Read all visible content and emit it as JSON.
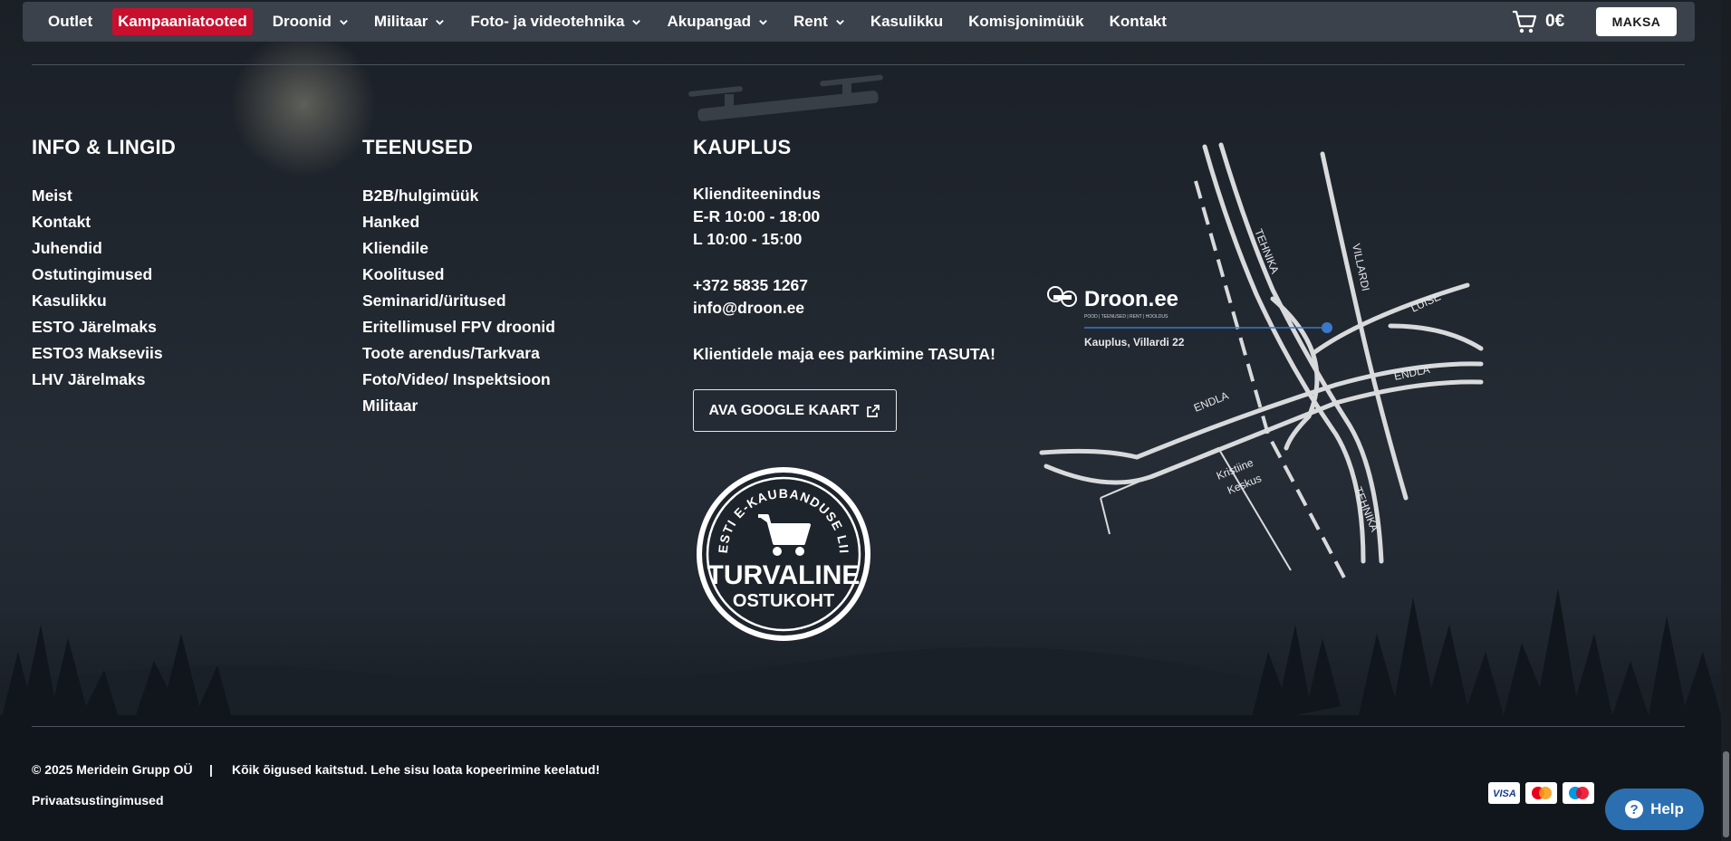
{
  "nav": {
    "items": [
      {
        "label": "Outlet",
        "dropdown": false
      },
      {
        "label": "Kampaaniatooted",
        "dropdown": false
      },
      {
        "label": "Droonid",
        "dropdown": true
      },
      {
        "label": "Militaar",
        "dropdown": true
      },
      {
        "label": "Foto- ja videotehnika",
        "dropdown": true
      },
      {
        "label": "Akupangad",
        "dropdown": true
      },
      {
        "label": "Rent",
        "dropdown": true
      },
      {
        "label": "Kasulikku",
        "dropdown": false
      },
      {
        "label": "Komisjonimüük",
        "dropdown": false
      },
      {
        "label": "Kontakt",
        "dropdown": false
      }
    ],
    "cart_total": "0€",
    "checkout_label": "MAKSA"
  },
  "footer": {
    "info": {
      "title": "INFO & LINGID",
      "links": [
        "Meist",
        "Kontakt",
        "Juhendid",
        "Ostutingimused",
        "Kasulikku",
        "ESTO Järelmaks",
        "ESTO3 Makseviis",
        "LHV Järelmaks"
      ]
    },
    "services": {
      "title": "TEENUSED",
      "links": [
        "B2B/hulgimüük",
        "Hanked",
        "Kliendile",
        "Koolitused",
        "Seminarid/üritused",
        "Eritellimusel FPV droonid",
        "Toote arendus/Tarkvara",
        "Foto/Video/ Inspektsioon",
        "Militaar"
      ]
    },
    "store": {
      "title": "KAUPLUS",
      "hours_title": "Klienditeenindus",
      "hours_weekdays": "E-R 10:00 - 18:00",
      "hours_saturday": "L 10:00 - 15:00",
      "phone": "+372 5835 1267",
      "email": "info@droon.ee",
      "parking": "Klientidele maja ees parkimine TASUTA!",
      "maps_button": "AVA GOOGLE KAART"
    },
    "badge": {
      "arc_text": "EESTI E-KAUBANDUSE LIIT",
      "line1": "TURVALINE",
      "line2": "OSTUKOHT"
    },
    "map": {
      "brand": "Droon.ee",
      "brand_sub": "POOD | TEENUSED | RENT | HOOLDUS",
      "address": "Kauplus, Villardi 22",
      "streets": [
        "TEHNIKA",
        "VILLARDI",
        "LUISE",
        "ENDLA",
        "ENDLA",
        "TEHNIKA"
      ],
      "mall_line1": "Kristiine",
      "mall_line2": "Keskus"
    },
    "copyright": "© 2025 Meridein Grupp OÜ",
    "separator": "|",
    "rights": "Kõik õigused kaitstud. Lehe sisu loata kopeerimine keelatud!",
    "privacy": "Privaatsustingimused",
    "payments": [
      "VISA",
      "Mastercard",
      "Maestro"
    ],
    "help_label": "Help"
  },
  "colors": {
    "campaign_red": "#c8102e",
    "navbar_bg": "#3b424b",
    "help_blue": "#2b6fb0"
  }
}
